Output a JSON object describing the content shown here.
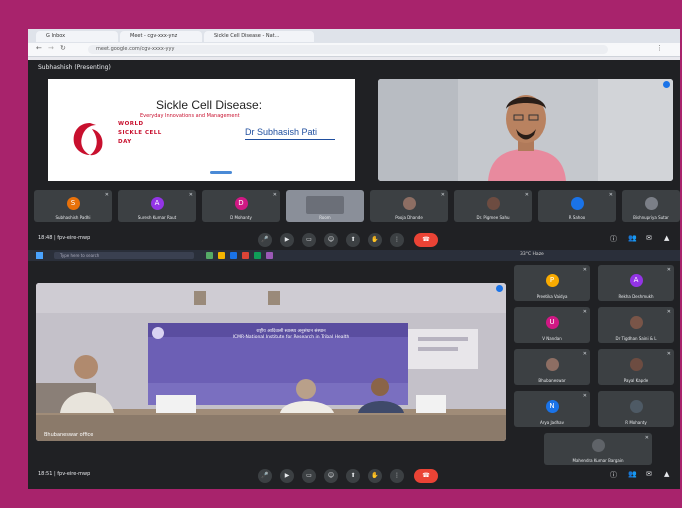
{
  "browser": {
    "tabs": [
      {
        "label": "G Inbox"
      },
      {
        "label": "Meet - cgv-xxx-ynz"
      },
      {
        "label": "Sickle Cell Disease - Nat..."
      }
    ],
    "address": "meet.google.com/cgv-xxxx-yyy"
  },
  "meeting1": {
    "title": "Subhashish (Presenting)",
    "slide": {
      "title": "Sickle Cell Disease:",
      "subtitle": "Everyday Innovations and Management",
      "logo_lines": [
        "WORLD",
        "SICKLE CELL",
        "DAY"
      ],
      "speaker": "Dr Subhasish Pati",
      "speaker_note": ""
    },
    "tiles": [
      {
        "name": "Subhashish Padhi",
        "initial": "S",
        "color": "#e8710a"
      },
      {
        "name": "Suresh Kumar Raut",
        "initial": "A",
        "color": "#9334e6"
      },
      {
        "name": "D Mohanty",
        "initial": "D",
        "color": "#d01884"
      },
      {
        "name": "Room",
        "initial": "",
        "color": "#5f6368"
      },
      {
        "name": "Pooja Dhande",
        "initial": "",
        "color": "#5f6368"
      },
      {
        "name": "Dr. Pigmee Sahu",
        "initial": "",
        "color": "#5f6368"
      },
      {
        "name": "R Sahoo",
        "initial": "",
        "color": "#1a73e8"
      },
      {
        "name": "Bishnupriya Sutar",
        "initial": "",
        "color": "#5f6368"
      }
    ],
    "time": "18:48 | fpv-eire-mwp",
    "end_label": "☎"
  },
  "taskbar": {
    "search_placeholder": "Type here to search",
    "temp": "33°C Haze"
  },
  "meeting2": {
    "stage_name": "Bhubaneswar office",
    "banner_line1": "राष्ट्रीय आदिवासी स्वास्थ्य अनुसंधान संस्थान",
    "banner_line2": "ICMR-National Institute for Research in Tribal Health",
    "tiles": [
      {
        "name": "Preetika Vaidya",
        "initial": "P",
        "color": "#f9ab00"
      },
      {
        "name": "Rekha Deshmukh",
        "initial": "A",
        "color": "#9334e6"
      },
      {
        "name": "V Nandan",
        "initial": "U",
        "color": "#d01884"
      },
      {
        "name": "Dr Tigdhan Saini & L",
        "initial": "",
        "color": "#5f6368"
      },
      {
        "name": "Bhubaneswar",
        "initial": "",
        "color": "#5f6368"
      },
      {
        "name": "Payal Kapde",
        "initial": "",
        "color": "#5f6368"
      },
      {
        "name": "Arya Jadhav",
        "initial": "N",
        "color": "#1a73e8"
      },
      {
        "name": "R Mohanty",
        "initial": "",
        "color": "#5f6368"
      },
      {
        "name": "Mahendra Kumar Bargain",
        "initial": "",
        "color": "#5f6368"
      }
    ],
    "time": "18:51 | fpv-eire-mwp",
    "end_label": "☎"
  }
}
